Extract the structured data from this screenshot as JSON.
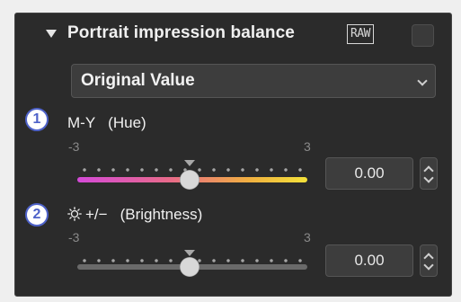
{
  "panel": {
    "title": "Portrait impression balance",
    "raw_badge": "RAW",
    "enabled": false
  },
  "preset_select": {
    "value": "Original Value"
  },
  "callouts": [
    "1",
    "2"
  ],
  "hue_slider": {
    "label": "M-Y",
    "sublabel": "(Hue)",
    "min_label": "-3",
    "max_label": "3",
    "value": "0.00"
  },
  "brightness_slider": {
    "label": "+/−",
    "sublabel": "(Brightness)",
    "min_label": "-3",
    "max_label": "3",
    "value": "0.00"
  },
  "colors": {
    "panel_bg": "#2b2b2b",
    "callout_accent": "#4e62c9",
    "hue_gradient_start": "#d44ad8",
    "hue_gradient_end": "#f4e23a"
  }
}
